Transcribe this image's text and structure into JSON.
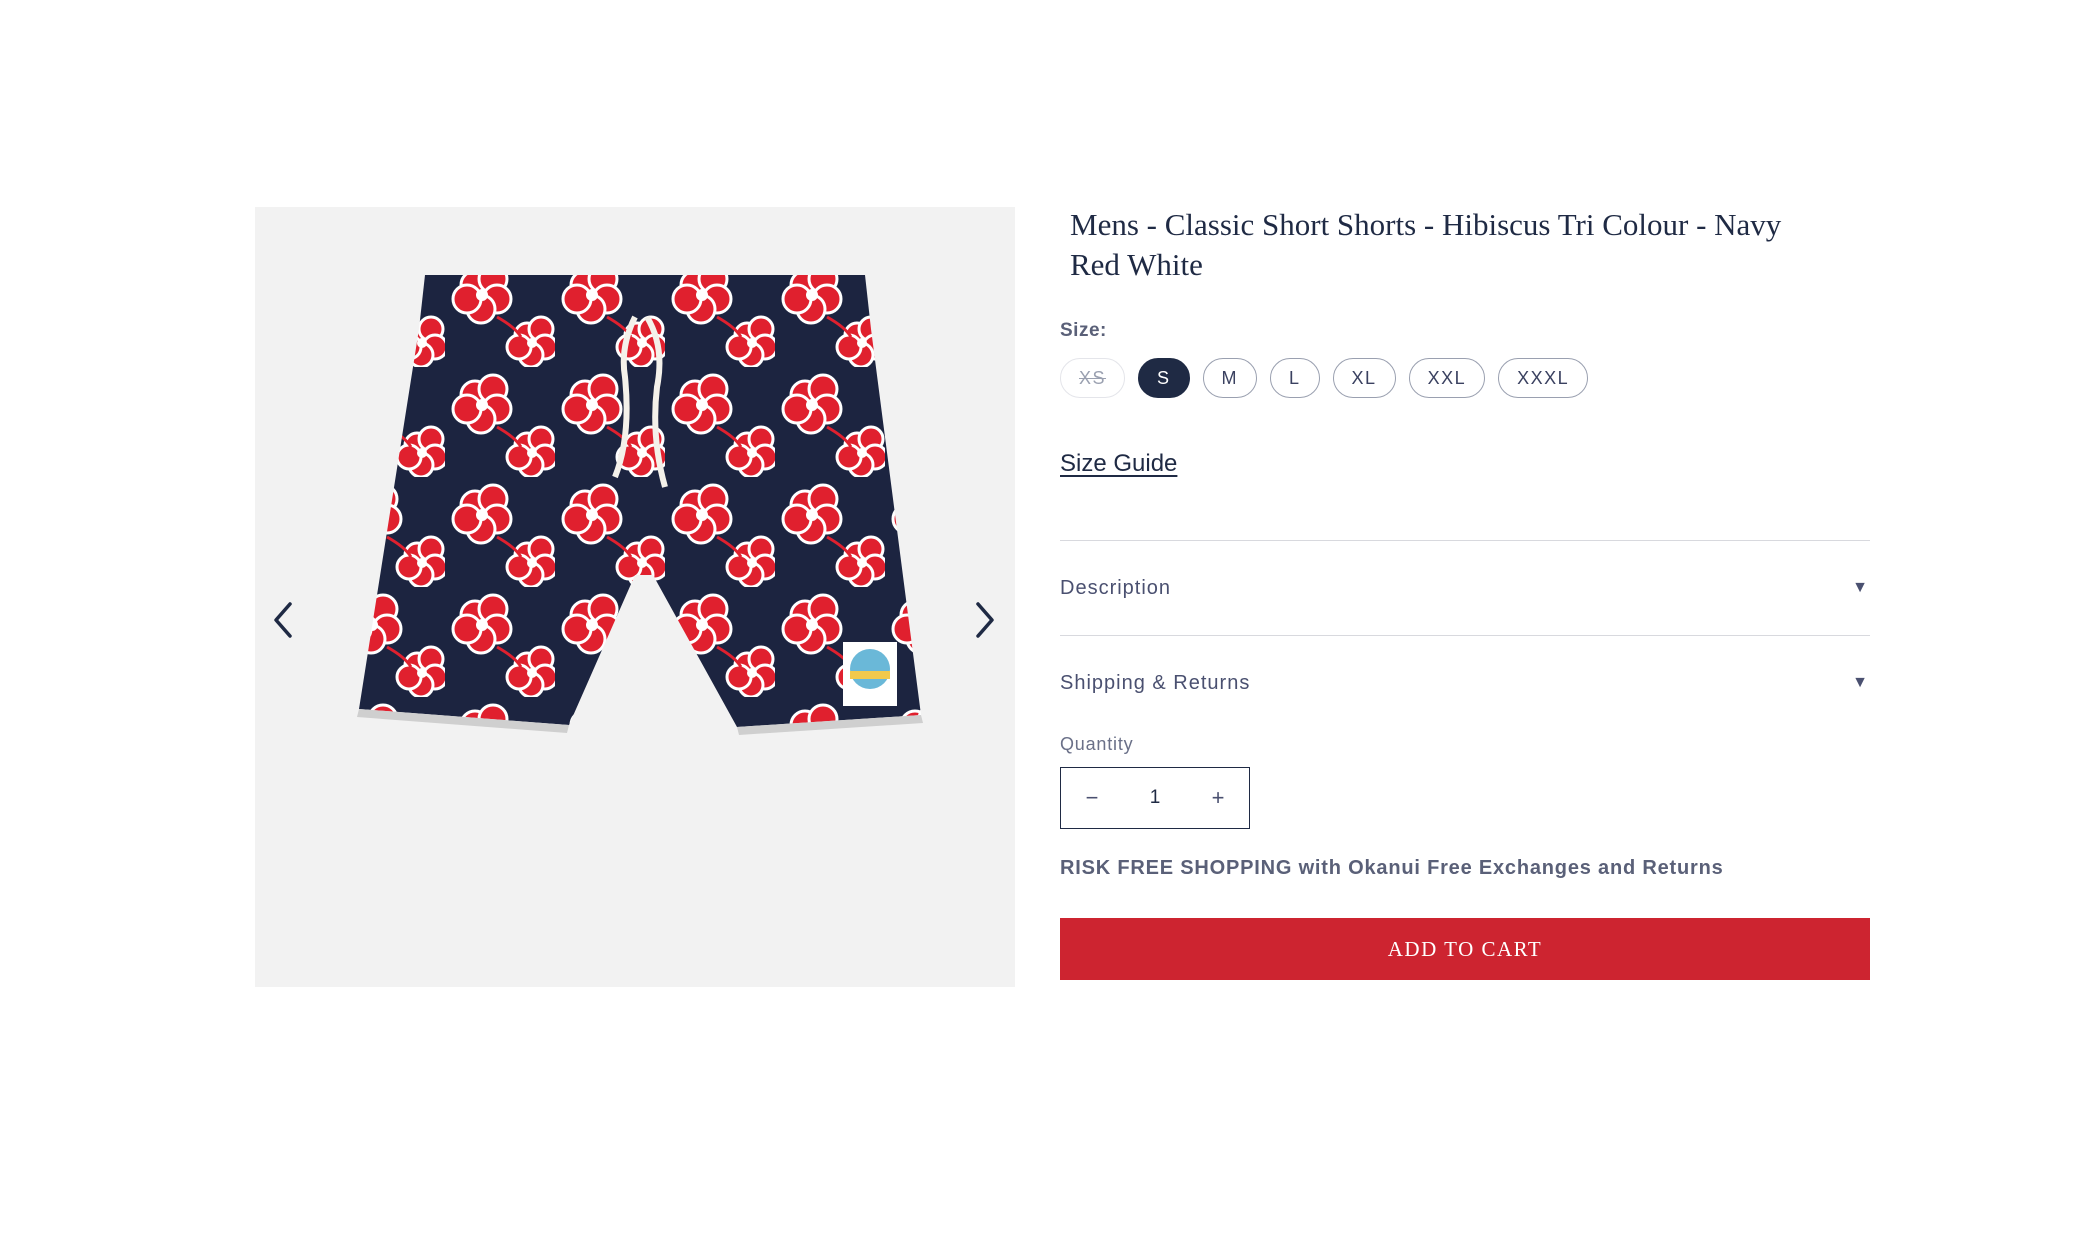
{
  "product": {
    "title": "Mens - Classic Short Shorts - Hibiscus Tri Colour - Navy Red White",
    "image_alt": "Hibiscus print short shorts in navy, red and white"
  },
  "gallery": {
    "prev_icon": "chevron-left-icon",
    "next_icon": "chevron-right-icon"
  },
  "size": {
    "label": "Size:",
    "options": [
      {
        "label": "XS",
        "state": "unavailable"
      },
      {
        "label": "S",
        "state": "selected"
      },
      {
        "label": "M",
        "state": "available"
      },
      {
        "label": "L",
        "state": "available"
      },
      {
        "label": "XL",
        "state": "available"
      },
      {
        "label": "XXL",
        "state": "available"
      },
      {
        "label": "XXXL",
        "state": "available"
      }
    ],
    "guide_label": "Size Guide"
  },
  "accordion": [
    {
      "label": "Description",
      "icon": "caret-down-icon"
    },
    {
      "label": "Shipping & Returns",
      "icon": "caret-down-icon"
    }
  ],
  "quantity": {
    "label": "Quantity",
    "value": "1",
    "minus": "−",
    "plus": "+"
  },
  "promo": "RISK FREE SHOPPING with Okanui Free Exchanges and Returns",
  "cart": {
    "button_label": "ADD TO CART"
  },
  "colors": {
    "navy": "#1f2a44",
    "red": "#cd2430",
    "gallery_bg": "#f2f2f2"
  }
}
